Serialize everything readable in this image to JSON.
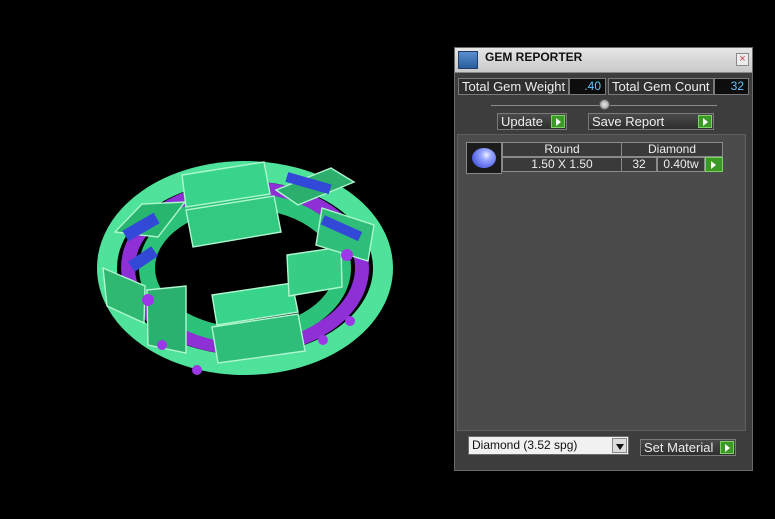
{
  "panel": {
    "title": "GEM REPORTER",
    "close_label": "×",
    "total_gem_weight_label": "Total Gem Weight",
    "total_gem_weight_value": ".40",
    "total_gem_count_label": "Total Gem Count",
    "total_gem_count_value": "32",
    "update_label": "Update",
    "save_report_label": "Save Report",
    "set_material_label": "Set Material",
    "material_selected": "Diamond (3.52 spg)"
  },
  "table": {
    "header": {
      "shape": "Round",
      "material": "Diamond"
    },
    "row": {
      "size": "1.50 X 1.50",
      "count": "32",
      "weight": "0.40tw"
    }
  },
  "colors": {
    "metal": "#39d48b",
    "gem": "#8f2fd6",
    "stone": "#3149d6",
    "play": "#3b9a25"
  }
}
